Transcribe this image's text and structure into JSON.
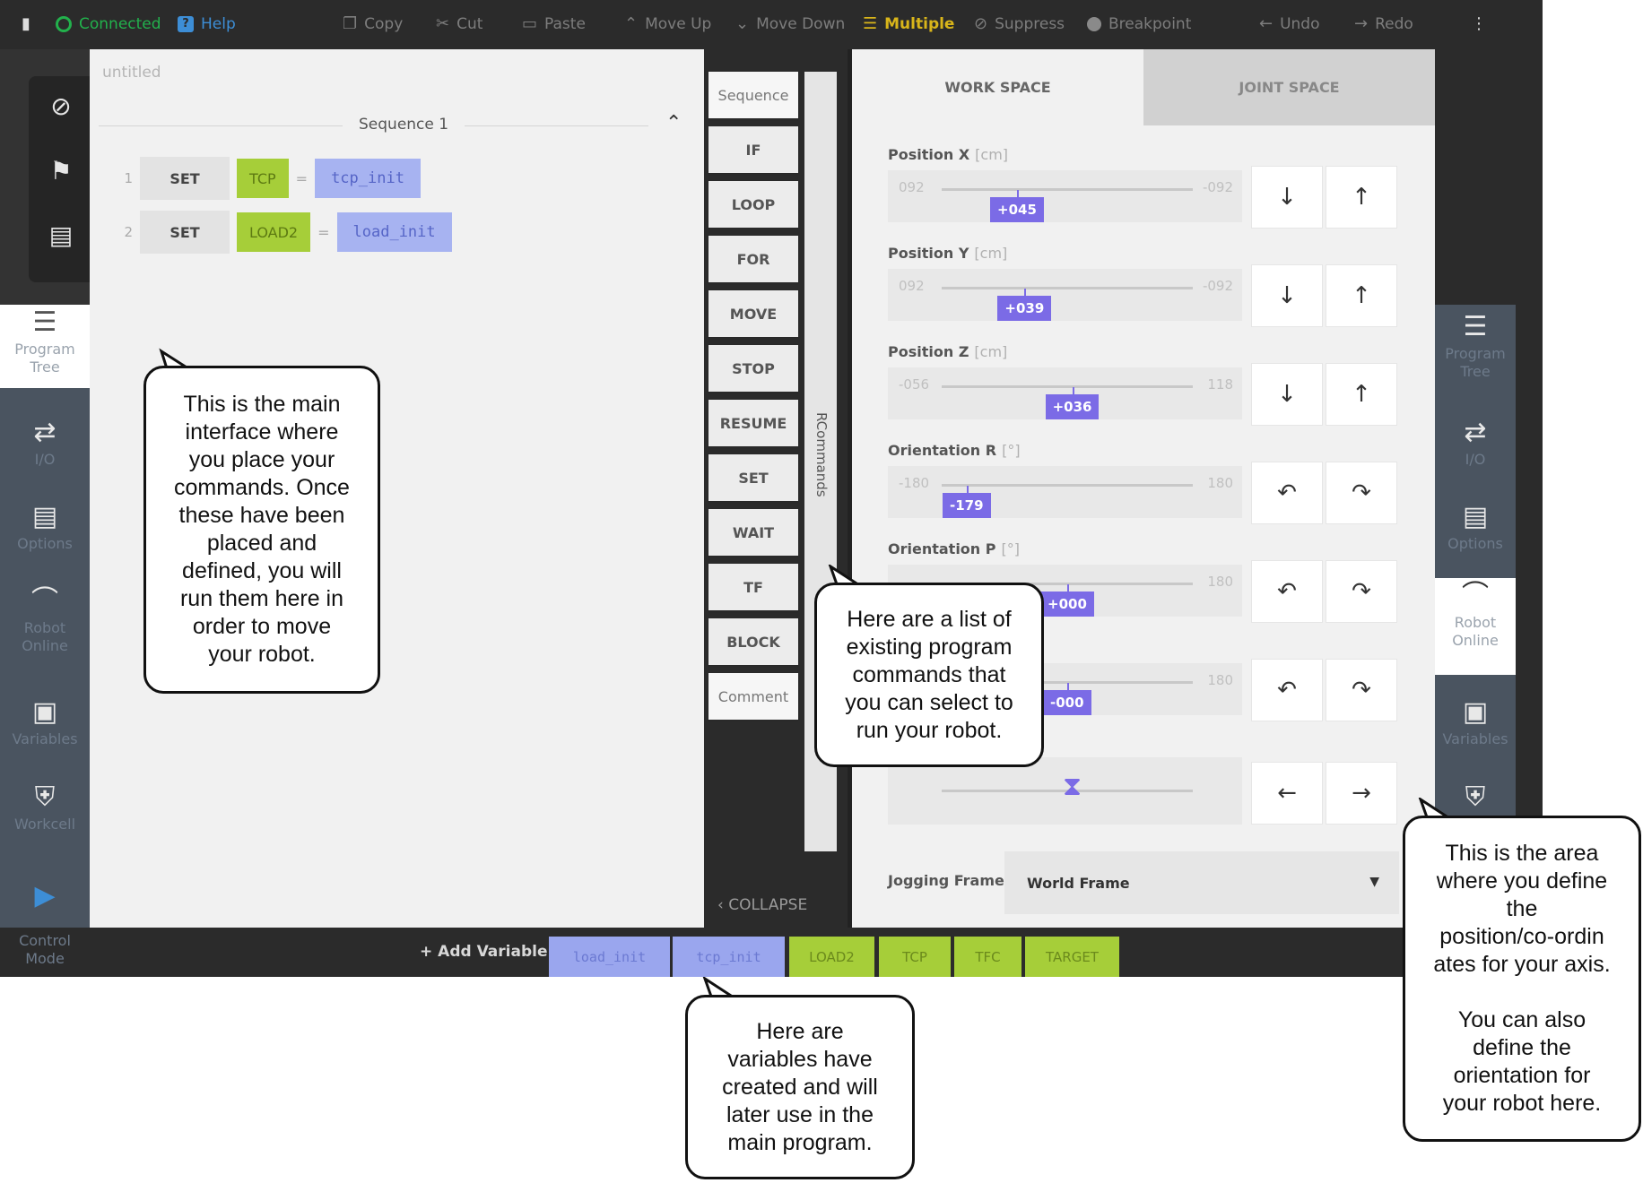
{
  "toolbar": {
    "connected": "Connected",
    "help": "Help",
    "copy": "Copy",
    "cut": "Cut",
    "paste": "Paste",
    "move_up": "Move Up",
    "move_down": "Move Down",
    "multiple": "Multiple",
    "suppress": "Suppress",
    "breakpoint": "Breakpoint",
    "undo": "Undo",
    "redo": "Redo"
  },
  "left_nav": {
    "items": [
      {
        "label": "Program Tree",
        "icon": "program-tree-icon"
      },
      {
        "label": "I/O",
        "icon": "io-icon"
      },
      {
        "label": "Options",
        "icon": "clipboard-icon"
      },
      {
        "label": "Robot Online",
        "icon": "robot-arm-icon"
      },
      {
        "label": "Variables",
        "icon": "briefcase-icon"
      },
      {
        "label": "Workcell",
        "icon": "shield-icon"
      }
    ],
    "control_mode": "Control Mode"
  },
  "program": {
    "title": "untitled",
    "sequence_title": "Sequence 1",
    "rows": [
      {
        "num": "1",
        "cmd": "SET",
        "var": "TCP",
        "eq": "=",
        "val": "tcp_init"
      },
      {
        "num": "2",
        "cmd": "SET",
        "var": "LOAD2",
        "eq": "=",
        "val": "load_init"
      }
    ]
  },
  "palette": {
    "items": [
      "Sequence",
      "IF",
      "LOOP",
      "FOR",
      "MOVE",
      "STOP",
      "RESUME",
      "SET",
      "WAIT",
      "TF",
      "BLOCK",
      "Comment"
    ],
    "side_label": "RCommands",
    "collapse": "COLLAPSE"
  },
  "jog": {
    "tab_work": "WORK SPACE",
    "tab_joint": "JOINT SPACE",
    "axes": [
      {
        "label": "Position X",
        "unit": "[cm]",
        "min": "092",
        "max": "-092",
        "value": "+045",
        "fraction": 0.3
      },
      {
        "label": "Position Y",
        "unit": "[cm]",
        "min": "092",
        "max": "-092",
        "value": "+039",
        "fraction": 0.33
      },
      {
        "label": "Position Z",
        "unit": "[cm]",
        "min": "-056",
        "max": "118",
        "value": "+036",
        "fraction": 0.52
      },
      {
        "label": "Orientation R",
        "unit": "[°]",
        "min": "-180",
        "max": "180",
        "value": "-179",
        "fraction": 0.1
      },
      {
        "label": "Orientation P",
        "unit": "[°]",
        "min": "",
        "max": "180",
        "value": "+000",
        "fraction": 0.5
      },
      {
        "label": "",
        "unit": "",
        "min": "",
        "max": "180",
        "value": "-000",
        "fraction": 0.5
      }
    ],
    "jogging_frame_label": "Jogging Frame",
    "jogging_frame_value": "World Frame"
  },
  "right_nav": {
    "items": [
      {
        "label": "Program Tree",
        "icon": "program-tree-icon"
      },
      {
        "label": "I/O",
        "icon": "io-icon"
      },
      {
        "label": "Options",
        "icon": "clipboard-icon"
      },
      {
        "label": "Robot Online",
        "icon": "robot-arm-icon"
      },
      {
        "label": "Variables",
        "icon": "briefcase-icon"
      }
    ]
  },
  "variables": {
    "add": "+ Add Variable",
    "chips": [
      {
        "name": "load_init",
        "kind": "blue"
      },
      {
        "name": "tcp_init",
        "kind": "blue"
      },
      {
        "name": "LOAD2",
        "kind": "green"
      },
      {
        "name": "TCP",
        "kind": "green"
      },
      {
        "name": "TFC",
        "kind": "green"
      },
      {
        "name": "TARGET",
        "kind": "green"
      }
    ]
  },
  "callouts": {
    "main": "This is the main\ninterface where\nyou place your\ncommands. Once\nthese have been\nplaced and\ndefined, you will\nrun them here in\norder to move\nyour robot.",
    "commands": "Here are a list of\nexisting program\ncommands that\nyou can select to\nrun your robot.",
    "variables": "Here are\nvariables have\ncreated and will\nlater use in the\nmain program.",
    "axis": "This is the area\nwhere you define\nthe\nposition/co-ordin\nates for your axis.\n\nYou can also\ndefine the\norientation for\nyour robot here."
  }
}
